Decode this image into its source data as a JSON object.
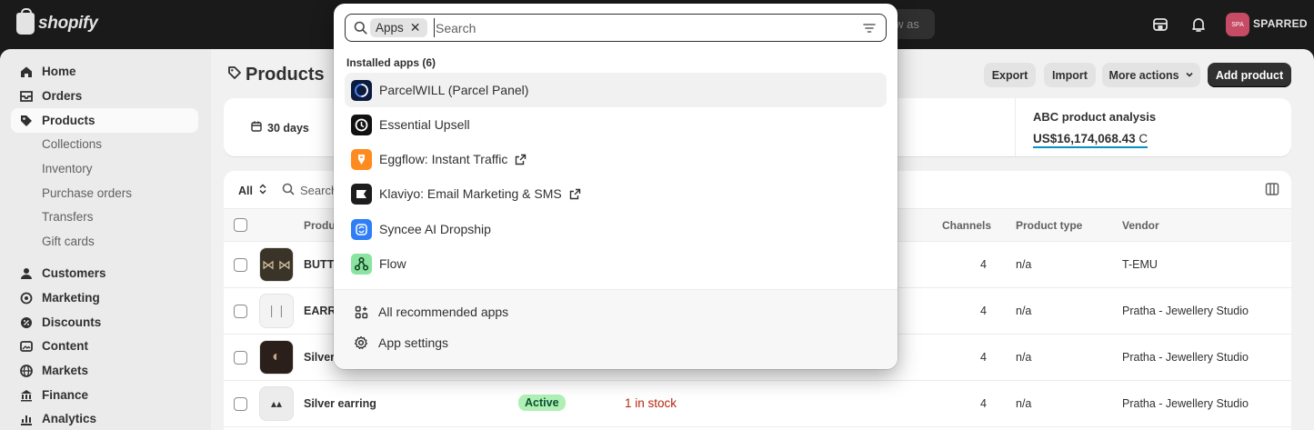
{
  "topbar": {
    "logo_text": "shopify",
    "view_as_partial": "iew as",
    "store_avatar_text": "SPA",
    "store_name": "SPARRED"
  },
  "sidebar": {
    "items": [
      {
        "label": "Home",
        "icon": "home-icon"
      },
      {
        "label": "Orders",
        "icon": "orders-icon"
      },
      {
        "label": "Products",
        "icon": "tag-icon",
        "active": true
      },
      {
        "label": "Customers",
        "icon": "person-icon"
      },
      {
        "label": "Marketing",
        "icon": "target-icon"
      },
      {
        "label": "Discounts",
        "icon": "discount-icon"
      },
      {
        "label": "Content",
        "icon": "content-icon"
      },
      {
        "label": "Markets",
        "icon": "globe-icon"
      },
      {
        "label": "Finance",
        "icon": "bank-icon"
      },
      {
        "label": "Analytics",
        "icon": "chart-icon"
      }
    ],
    "product_subitems": [
      "Collections",
      "Inventory",
      "Purchase orders",
      "Transfers",
      "Gift cards"
    ]
  },
  "page": {
    "title": "Products",
    "actions": {
      "export": "Export",
      "import": "Import",
      "more_actions": "More actions",
      "add_product": "Add product"
    }
  },
  "stats": {
    "date_range": "30 days",
    "abc_title": "ABC product analysis",
    "abc_value": "US$16,174,068.43",
    "abc_suffix": "C"
  },
  "table": {
    "filter_all": "All",
    "search_partial": "Search",
    "headers": {
      "product": "Produ",
      "channels": "Channels",
      "product_type": "Product type",
      "vendor": "Vendor"
    },
    "rows": [
      {
        "product": "BUTTE",
        "status": "",
        "inventory": "",
        "channels": "4",
        "type": "n/a",
        "vendor": "T-EMU"
      },
      {
        "product": "EARRI",
        "status": "",
        "inventory": "",
        "channels": "4",
        "type": "n/a",
        "vendor": "Pratha - Jewellery Studio"
      },
      {
        "product": "Silver",
        "status": "",
        "inventory": "",
        "channels": "4",
        "type": "n/a",
        "vendor": "Pratha - Jewellery Studio"
      },
      {
        "product": "Silver earring",
        "status": "Active",
        "inventory": "1 in stock",
        "channels": "4",
        "type": "n/a",
        "vendor": "Pratha - Jewellery Studio"
      }
    ]
  },
  "search": {
    "tag": "Apps",
    "placeholder": "Search",
    "section_label": "Installed apps (6)",
    "apps": [
      {
        "name": "ParcelWILL (Parcel Panel)",
        "icon": "parcelwill-logo",
        "external": false
      },
      {
        "name": "Essential Upsell",
        "icon": "essential-upsell-logo",
        "external": false
      },
      {
        "name": "Eggflow: Instant Traffic",
        "icon": "eggflow-logo",
        "external": true
      },
      {
        "name": "Klaviyo: Email Marketing & SMS",
        "icon": "klaviyo-logo",
        "external": true
      },
      {
        "name": "Syncee AI Dropship",
        "icon": "syncee-logo",
        "external": false
      },
      {
        "name": "Flow",
        "icon": "flow-logo",
        "external": false
      }
    ],
    "footer": {
      "recommended": "All recommended apps",
      "settings": "App settings"
    }
  },
  "colors": {
    "topbar": "#1a1a1a",
    "primary_button": "#303030",
    "active_badge": "#aff0b5",
    "inventory_low": "#b5260b",
    "abc_underline": "#0b8fc4"
  }
}
